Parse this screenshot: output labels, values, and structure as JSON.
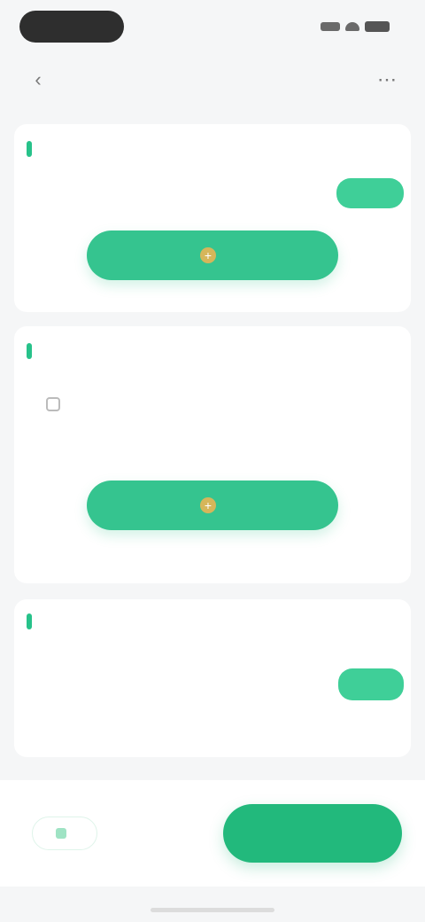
{
  "status_bar": {
    "time": "",
    "icons": [
      "signal-icon",
      "wifi-icon",
      "battery-icon"
    ]
  },
  "header": {
    "title": "",
    "back_icon": "chevron-left-icon",
    "more_icon": "more-icon"
  },
  "section1": {
    "title": "",
    "link": "",
    "hint": "",
    "hint_highlight": "",
    "tag_button": "",
    "add_button": ""
  },
  "section2": {
    "title": "",
    "link": "",
    "option_label": "",
    "add_button": ""
  },
  "section3": {
    "title": "",
    "subtitle": "",
    "row_label": "",
    "toggle_button": ""
  },
  "bottom": {
    "draft_button": "",
    "submit_button": ""
  },
  "colors": {
    "accent": "#27c28a",
    "button": "#35c48f",
    "submit": "#22b97c",
    "background": "#f5f6f7"
  }
}
